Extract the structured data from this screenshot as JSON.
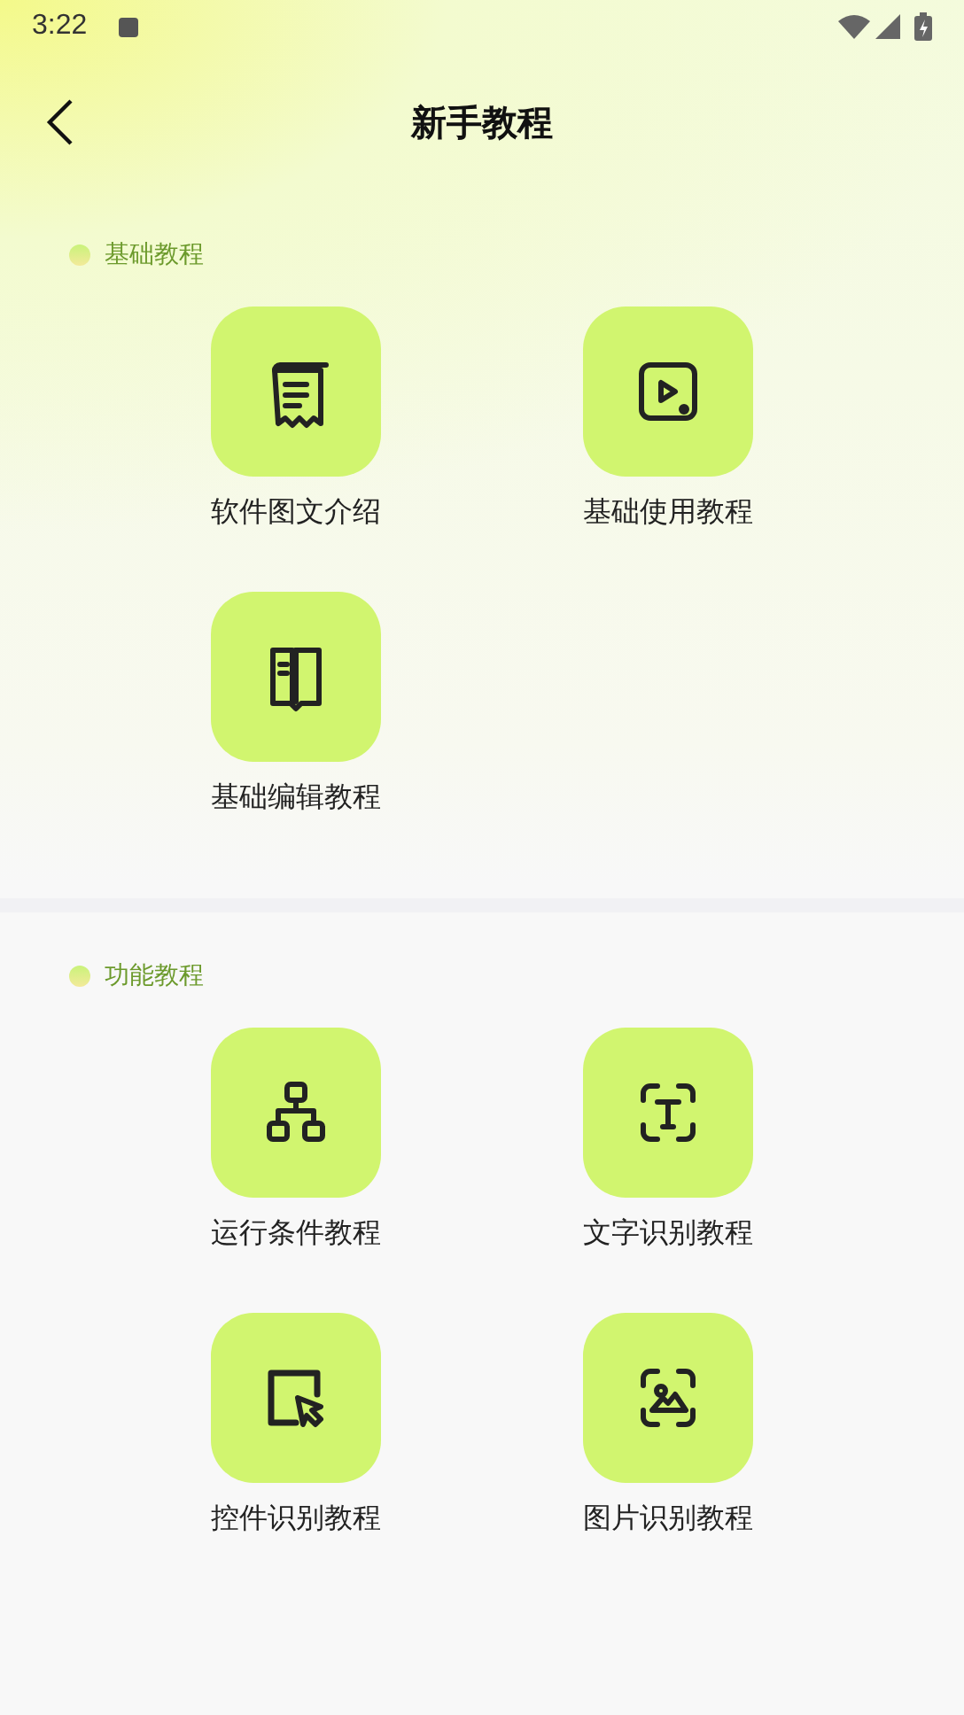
{
  "status_bar": {
    "time": "3:22"
  },
  "header": {
    "title": "新手教程"
  },
  "sections": [
    {
      "title": "基础教程",
      "items": [
        {
          "label": "软件图文介绍",
          "kind": "scroll"
        },
        {
          "label": "基础使用教程",
          "kind": "play"
        },
        {
          "label": "基础编辑教程",
          "kind": "book"
        }
      ]
    },
    {
      "title": "功能教程",
      "items": [
        {
          "label": "运行条件教程",
          "kind": "hierarchy"
        },
        {
          "label": "文字识别教程",
          "kind": "text-scan"
        },
        {
          "label": "控件识别教程",
          "kind": "cursor-select"
        },
        {
          "label": "图片识别教程",
          "kind": "image-scan"
        }
      ]
    }
  ]
}
